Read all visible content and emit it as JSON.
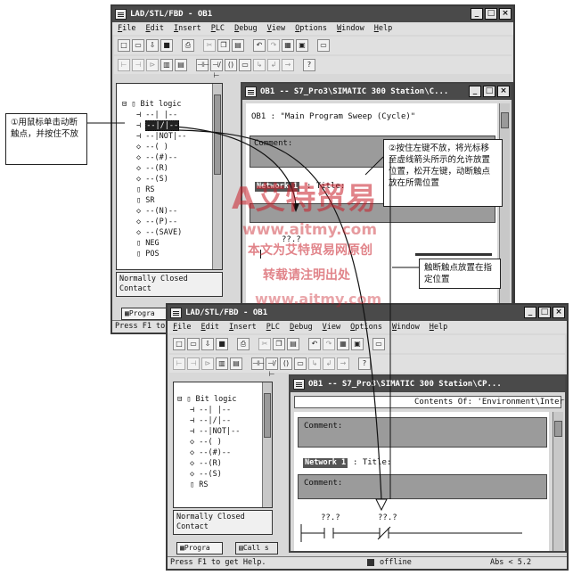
{
  "top_window": {
    "title": "LAD/STL/FBD   - OB1",
    "menu": [
      "File",
      "Edit",
      "Insert",
      "PLC",
      "Debug",
      "View",
      "Options",
      "Window",
      "Help"
    ],
    "tree": {
      "root": "Bit logic",
      "items": [
        "--|  |--",
        "--|/|--",
        "--|NOT|--",
        "--( )",
        "--(#)--",
        "--(R)",
        "--(S)",
        "RS",
        "SR",
        "--(N)--",
        "--(P)--",
        "--(SAVE)",
        "NEG",
        "POS"
      ]
    },
    "description": "Normally Closed Contact",
    "tab": "Progra",
    "status": "Press F1 to ge"
  },
  "top_inner": {
    "title": "OB1 -- S7_Pro3\\SIMATIC 300 Station\\C...",
    "header": "OB1 :  \"Main Program Sweep (Cycle)\"",
    "comment": "Comment:",
    "network": "Network 1",
    "network_title": ": Title:",
    "operand": "??.?"
  },
  "bottom_window": {
    "title": "LAD/STL/FBD   - OB1",
    "menu": [
      "File",
      "Edit",
      "Insert",
      "PLC",
      "Debug",
      "View",
      "Options",
      "Window",
      "Help"
    ],
    "tree": {
      "root": "Bit logic",
      "items": [
        "--|  |--",
        "--|/|--",
        "--|NOT|--",
        "--( )",
        "--(#)--",
        "--(R)",
        "--(S)",
        "RS"
      ]
    },
    "description": "Normally Closed Contact",
    "tabs": [
      "Progra",
      "Call s"
    ],
    "status": "Press F1 to get Help.",
    "status_mode": "offline",
    "status_pos": "Abs < 5.2"
  },
  "bottom_inner": {
    "title": "OB1 -- S7_Pro3\\SIMATIC 300 Station\\CP...",
    "contents": "Contents Of: 'Environment\\Interface'",
    "comment": "Comment:",
    "network": "Network 1",
    "network_title": ": Title:",
    "comment2": "Comment:",
    "operand1": "??.?",
    "operand2": "??.?"
  },
  "callouts": {
    "c1": "①用鼠标单击动断触点，并按住不放",
    "c2": "②按住左键不放，将光标移至虚线箭头所示的允许放置位置，松开左键，动断触点放在所需位置",
    "c3": "触断触点放置在指定位置"
  },
  "watermark": {
    "brand": "艾特贸易",
    "url": "www.aitmy.com",
    "line1_a": "本文为",
    "line1_b": "艾特贸易网",
    "line1_c": "原创",
    "line2": "转载请注明出处"
  }
}
